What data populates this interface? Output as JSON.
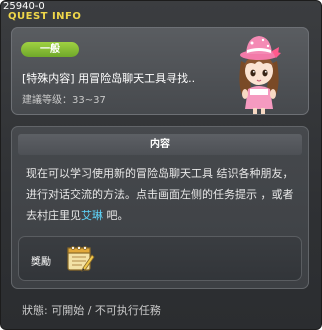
{
  "window": {
    "quest_id": "25940-0",
    "title": "QUEST INFO"
  },
  "header": {
    "tag": "一般",
    "quest_name": "[特殊内容] 用冒险岛聊天工具寻找..",
    "level_label": "建議等级：",
    "level_range": "33~37",
    "npc_icon": "pink-hat-girl-npc-icon"
  },
  "content": {
    "heading": "内容",
    "description_before": "现在可以学习使用新的冒险岛聊天工具 结识各种朋友，进行对话交流的方法。点击画面左侧的任务提示 ，或者去村庄里见",
    "npc_name": "艾琳",
    "description_after": " 吧。"
  },
  "reward": {
    "label": "獎勵",
    "icon": "quest-notepad-icon"
  },
  "status": {
    "text": "狀態: 可開始 / 不可执行任務"
  },
  "colors": {
    "title": "#f0d74a",
    "tag_green": "#8bc53a",
    "npc_highlight": "#5fd9ff",
    "panel": "#46494d",
    "background": "#2f3134"
  }
}
